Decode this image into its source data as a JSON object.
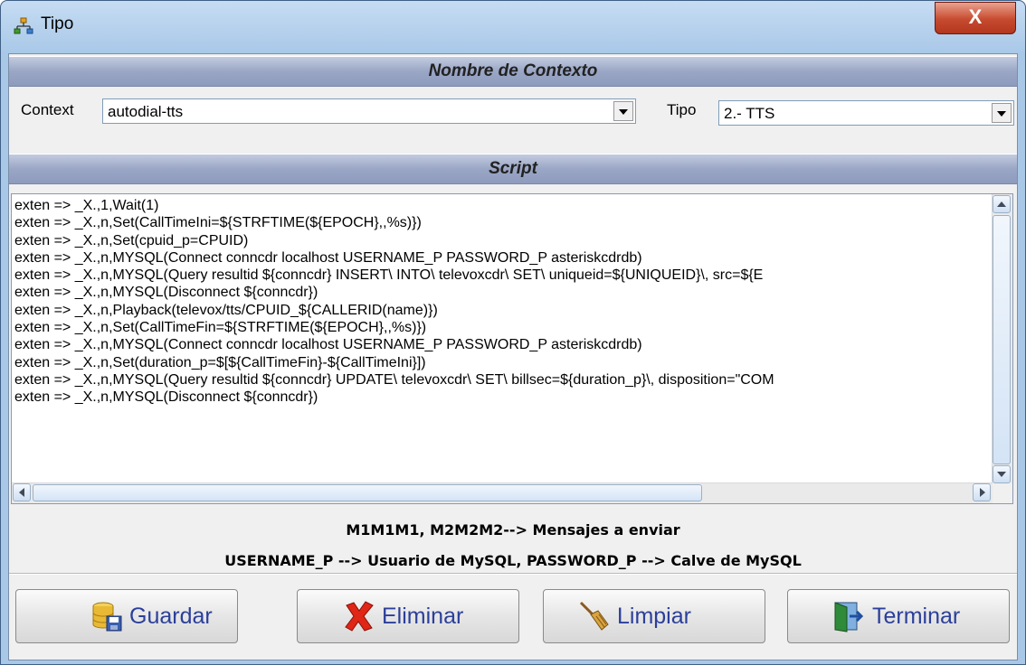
{
  "window": {
    "title": "Tipo",
    "close_label": "X"
  },
  "section_context": {
    "header": "Nombre de Contexto"
  },
  "context": {
    "label": "Context",
    "value": "autodial-tts"
  },
  "tipo": {
    "label": "Tipo",
    "value": "2.- TTS"
  },
  "section_script": {
    "header": "Script"
  },
  "script": {
    "lines": [
      "exten => _X.,1,Wait(1)",
      "exten => _X.,n,Set(CallTimeIni=${STRFTIME(${EPOCH},,%s)})",
      "exten => _X.,n,Set(cpuid_p=CPUID)",
      "exten => _X.,n,MYSQL(Connect conncdr localhost USERNAME_P PASSWORD_P asteriskcdrdb)",
      "exten => _X.,n,MYSQL(Query resultid ${conncdr} INSERT\\ INTO\\ televoxcdr\\ SET\\ uniqueid=${UNIQUEID}\\, src=${E",
      "exten => _X.,n,MYSQL(Disconnect ${conncdr})",
      "exten => _X.,n,Playback(televox/tts/CPUID_${CALLERID(name)})",
      "exten => _X.,n,Set(CallTimeFin=${STRFTIME(${EPOCH},,%s)})",
      "exten => _X.,n,MYSQL(Connect conncdr localhost USERNAME_P PASSWORD_P asteriskcdrdb)",
      "exten => _X.,n,Set(duration_p=$[${CallTimeFin}-${CallTimeIni}])",
      "exten => _X.,n,MYSQL(Query resultid ${conncdr} UPDATE\\ televoxcdr\\ SET\\ billsec=${duration_p}\\, disposition=\"COM",
      "exten => _X.,n,MYSQL(Disconnect ${conncdr})"
    ]
  },
  "info": {
    "line1": "M1M1M1, M2M2M2--> Mensajes a enviar",
    "line2": "USERNAME_P --> Usuario de MySQL, PASSWORD_P --> Calve de MySQL"
  },
  "buttons": {
    "guardar": "Guardar",
    "eliminar": "Eliminar",
    "limpiar": "Limpiar",
    "terminar": "Terminar"
  }
}
